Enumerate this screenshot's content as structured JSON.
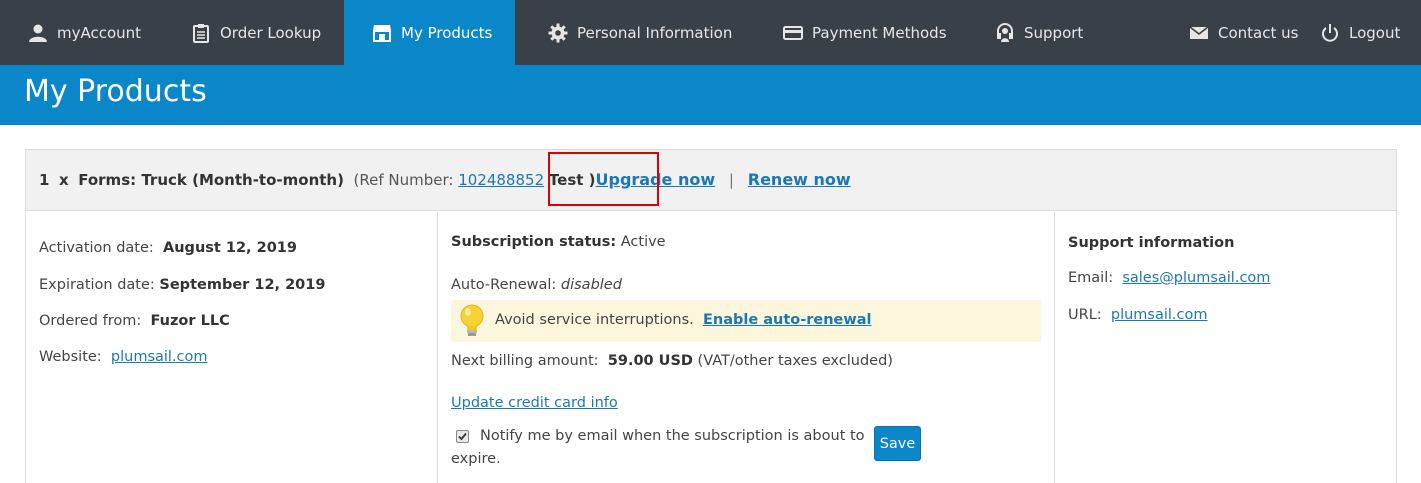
{
  "nav": {
    "items": [
      {
        "label": "myAccount",
        "icon": "user-icon"
      },
      {
        "label": "Order Lookup",
        "icon": "clipboard-icon"
      },
      {
        "label": "My Products",
        "icon": "store-icon",
        "active": true
      },
      {
        "label": "Personal Information",
        "icon": "gear-icon"
      },
      {
        "label": "Payment Methods",
        "icon": "credit-card-icon"
      },
      {
        "label": "Support",
        "icon": "headset-icon"
      },
      {
        "label": "Contact us",
        "icon": "envelope-icon"
      },
      {
        "label": "Logout",
        "icon": "power-icon"
      }
    ]
  },
  "page_title": "My Products",
  "product": {
    "quantity": "1",
    "times": "x",
    "name": "Forms: Truck (Month-to-month)",
    "ref_prefix": "(Ref Number:",
    "ref_number": "102488852",
    "ref_suffix": "Test )",
    "upgrade_label": "Upgrade now",
    "separator": "|",
    "renew_label": "Renew now"
  },
  "details": {
    "activation_label": "Activation date:",
    "activation_value": "August 12, 2019",
    "expiration_label": "Expiration date:",
    "expiration_value": "September 12, 2019",
    "ordered_label": "Ordered from:",
    "ordered_value": "Fuzor LLC",
    "website_label": "Website:",
    "website_value": "plumsail.com"
  },
  "subscription": {
    "status_label": "Subscription status:",
    "status_value": "Active",
    "autorenew_label": "Auto-Renewal:",
    "autorenew_value": "disabled",
    "notice_text": "Avoid service interruptions.",
    "notice_link": "Enable auto-renewal",
    "billing_label": "Next billing amount:",
    "billing_value": "59.00 USD",
    "billing_note": "(VAT/other taxes excluded)",
    "update_card_link": "Update credit card info",
    "notify_text": "Notify me by email when the subscription is about to expire.",
    "notify_checked": true,
    "save_label": "Save"
  },
  "support": {
    "heading": "Support information",
    "email_label": "Email:",
    "email_value": "sales@plumsail.com",
    "url_label": "URL:",
    "url_value": "plumsail.com"
  },
  "colors": {
    "nav_bg": "#3a4048",
    "accent": "#0a87c8",
    "highlight": "#e00000",
    "notice_bg": "#fbf6dc",
    "link": "#1b78b8"
  }
}
